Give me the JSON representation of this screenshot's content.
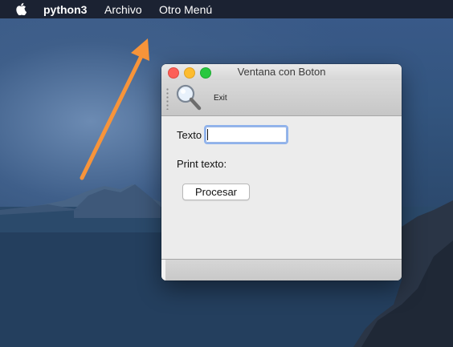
{
  "menubar": {
    "apple_icon": "apple-icon",
    "app_name": "python3",
    "items": [
      {
        "label": "Archivo"
      },
      {
        "label": "Otro Menú"
      }
    ]
  },
  "window": {
    "title": "Ventana con Boton",
    "toolbar": {
      "tool_icon": "magnifier-icon",
      "exit_label": "Exit"
    },
    "form": {
      "texto_label": "Texto",
      "texto_value": "",
      "print_label": "Print texto:",
      "procesar_label": "Procesar"
    }
  },
  "annotation": {
    "arrow_icon": "arrow-icon",
    "arrow_color": "#f7943a"
  },
  "colors": {
    "menubar": "#1b2232",
    "close": "#fc5f57",
    "minimize": "#fdbc2e",
    "maximize": "#28c840"
  }
}
